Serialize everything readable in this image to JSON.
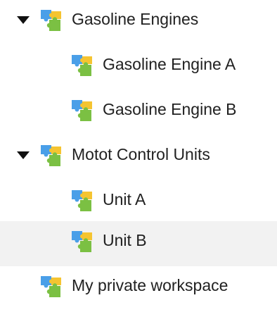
{
  "tree": {
    "nodes": [
      {
        "label": "Gasoline Engines",
        "expanded": true,
        "icon": "workspace-puzzle-icon",
        "level": 0
      },
      {
        "label": "Gasoline Engine A",
        "icon": "workspace-puzzle-icon",
        "level": 1
      },
      {
        "label": "Gasoline Engine B",
        "icon": "workspace-puzzle-icon",
        "level": 1
      },
      {
        "label": "Motot Control Units",
        "expanded": true,
        "icon": "workspace-puzzle-icon",
        "level": 0
      },
      {
        "label": "Unit A",
        "icon": "workspace-puzzle-icon",
        "level": 1
      },
      {
        "label": "Unit B",
        "icon": "workspace-puzzle-icon",
        "level": 1,
        "selected": true
      },
      {
        "label": "My private workspace",
        "icon": "workspace-puzzle-icon",
        "level": 0
      }
    ]
  },
  "colors": {
    "selected_row_bg": "#f2f2f2",
    "puzzle_blue": "#4A9FE8",
    "puzzle_yellow": "#F5C431",
    "puzzle_green": "#7BC043",
    "caret": "#111111"
  }
}
